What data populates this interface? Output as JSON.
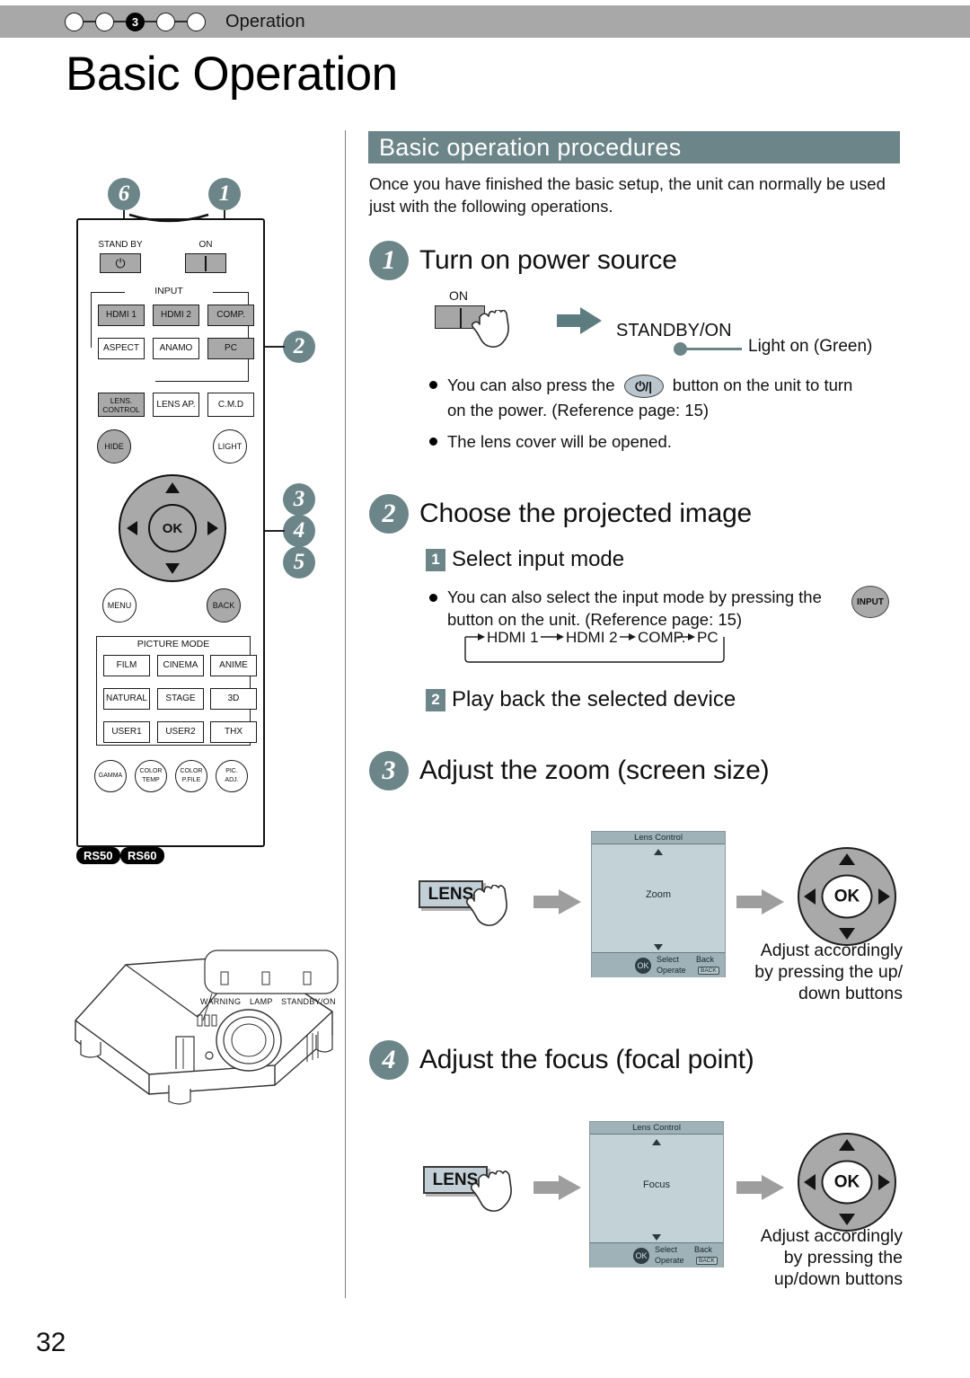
{
  "header": {
    "breadcrumb_label": "Operation",
    "active_step": "3",
    "dots": [
      "",
      "",
      "3",
      "",
      ""
    ]
  },
  "page_title": "Basic Operation",
  "page_number": "32",
  "section": {
    "banner": "Basic operation procedures",
    "intro": "Once you have finished the basic setup, the unit can normally be used just with the following operations."
  },
  "steps": [
    {
      "num": "1",
      "title": "Turn on power source",
      "on_label": "ON",
      "standby_on_label": "STANDBY/ON",
      "light_note": "Light on (Green)",
      "bullets": [
        "You can also press the ⏻ button on the unit to turn on the power. (Reference page: 15)",
        "The lens cover will be opened."
      ],
      "bullet1_pre": "You can also press the",
      "bullet1_post": "button on the unit to turn",
      "bullet1_line2": "on the power. (Reference page: 15)",
      "bullet2": "The lens cover will be opened.",
      "power_glyph": "⏻/|"
    },
    {
      "num": "2",
      "title": "Choose the projected image",
      "substeps": [
        {
          "num": "1",
          "title": "Select input mode"
        },
        {
          "num": "2",
          "title": "Play back the selected device"
        }
      ],
      "bullet_line1": "You can also select the input mode by pressing the",
      "bullet_line2": "button on the unit. (Reference page: 15)",
      "input_button_label": "INPUT",
      "sequence": [
        "HDMI 1",
        "HDMI 2",
        "COMP.",
        "PC"
      ]
    },
    {
      "num": "3",
      "title": "Adjust the zoom (screen size)",
      "lens_key_label": "LENS",
      "osd": {
        "title": "Lens Control",
        "mode": "Zoom",
        "select": "Select",
        "operate": "Operate",
        "back": "Back",
        "back_key": "BACK",
        "knob": "OK"
      },
      "ok_label": "OK",
      "note": "Adjust accordingly by pressing the up/ down buttons",
      "note_lines": [
        "Adjust accordingly",
        "by pressing the up/",
        "down buttons"
      ]
    },
    {
      "num": "4",
      "title": "Adjust the focus (focal point)",
      "lens_key_label": "LENS",
      "osd": {
        "title": "Lens Control",
        "mode": "Focus",
        "select": "Select",
        "operate": "Operate",
        "back": "Back",
        "back_key": "BACK",
        "knob": "OK"
      },
      "ok_label": "OK",
      "note_lines": [
        "Adjust accordingly",
        "by pressing the",
        "up/down buttons"
      ]
    }
  ],
  "remote": {
    "standby_label": "STAND BY",
    "on_label": "ON",
    "power_glyph": "⏻",
    "input_group_title": "INPUT",
    "input_keys": [
      "HDMI 1",
      "HDMI 2",
      "COMP."
    ],
    "aspect_keys": [
      "ASPECT",
      "ANAMO",
      "PC"
    ],
    "lens_row": [
      "LENS. CONTROL",
      "LENS AP.",
      "C.M.D"
    ],
    "lens_control_line1": "LENS.",
    "lens_control_line2": "CONTROL",
    "hide": "HIDE",
    "light": "LIGHT",
    "ok": "OK",
    "menu": "MENU",
    "back": "BACK",
    "picture_mode_title": "PICTURE MODE",
    "picture_modes": [
      "FILM",
      "CINEMA",
      "ANIME",
      "NATURAL",
      "STAGE",
      "3D",
      "USER1",
      "USER2",
      "THX"
    ],
    "bottom_keys": [
      {
        "l1": "GAMMA",
        "l2": ""
      },
      {
        "l1": "COLOR",
        "l2": "TEMP"
      },
      {
        "l1": "COLOR",
        "l2": "P.FILE"
      },
      {
        "l1": "PIC.",
        "l2": "ADJ."
      }
    ],
    "models": [
      "RS50",
      "RS60"
    ],
    "callouts": [
      "6",
      "1",
      "2",
      "3",
      "4",
      "5"
    ]
  },
  "projector": {
    "indicator_labels": [
      "WARNING",
      "LAMP",
      "STANDBY/ON"
    ]
  },
  "colors": {
    "accent_teal": "#6c8588",
    "header_grey": "#a8a8a8",
    "key_grey": "#a9a9a9",
    "osd_bg": "#c3d2d6",
    "osd_bar": "#9fb2b8",
    "lens_key": "#c3cfd6"
  }
}
